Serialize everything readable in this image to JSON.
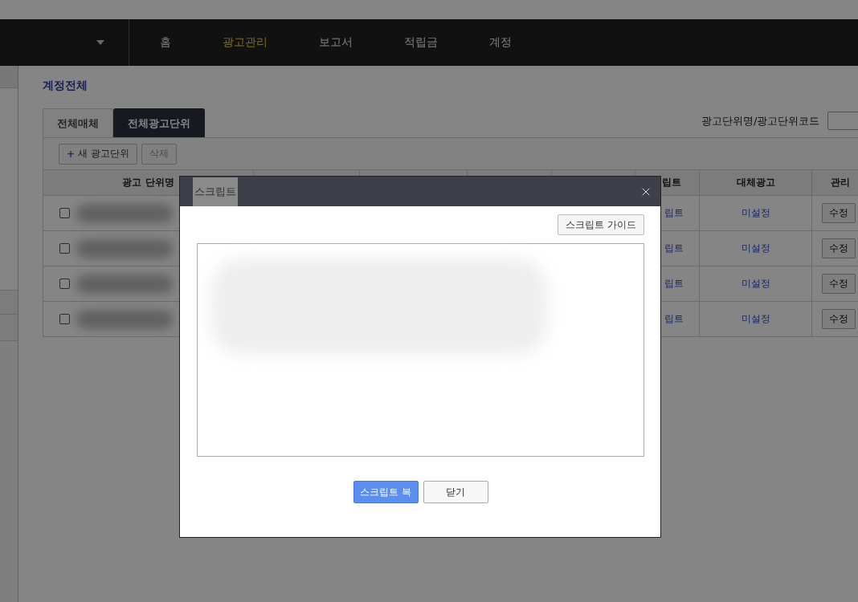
{
  "nav": {
    "items": [
      {
        "label": "홈",
        "selected": false
      },
      {
        "label": "광고관리",
        "selected": true
      },
      {
        "label": "보고서",
        "selected": false
      },
      {
        "label": "적립금",
        "selected": false
      },
      {
        "label": "계정",
        "selected": false
      }
    ]
  },
  "page_title": "계정전체",
  "tabs": [
    {
      "label": "전체매체",
      "selected": false
    },
    {
      "label": "전체광고단위",
      "selected": true
    }
  ],
  "search": {
    "label": "광고단위명/광고단위코드"
  },
  "toolbar": {
    "new_button": {
      "icon": "+",
      "label": "새 광고단위"
    },
    "delete_button": {
      "label": "삭제",
      "disabled": true
    }
  },
  "table": {
    "columns": [
      "광고 단위명",
      "립트",
      "대체광고",
      "관리"
    ],
    "rows": [
      {
        "checked": false,
        "script": "립트",
        "fallback": "미설정",
        "action": "수정"
      },
      {
        "checked": false,
        "script": "립트",
        "fallback": "미설정",
        "action": "수정"
      },
      {
        "checked": false,
        "script": "립트",
        "fallback": "미설정",
        "action": "수정"
      },
      {
        "checked": false,
        "script": "립트",
        "fallback": "미설정",
        "action": "수정"
      }
    ]
  },
  "modal": {
    "title": "스크립트",
    "guide_button": "스크립트 가이드",
    "buttons": [
      {
        "label": "스크립트 복",
        "kind": "primary"
      },
      {
        "label": "닫기",
        "kind": "default"
      }
    ]
  }
}
